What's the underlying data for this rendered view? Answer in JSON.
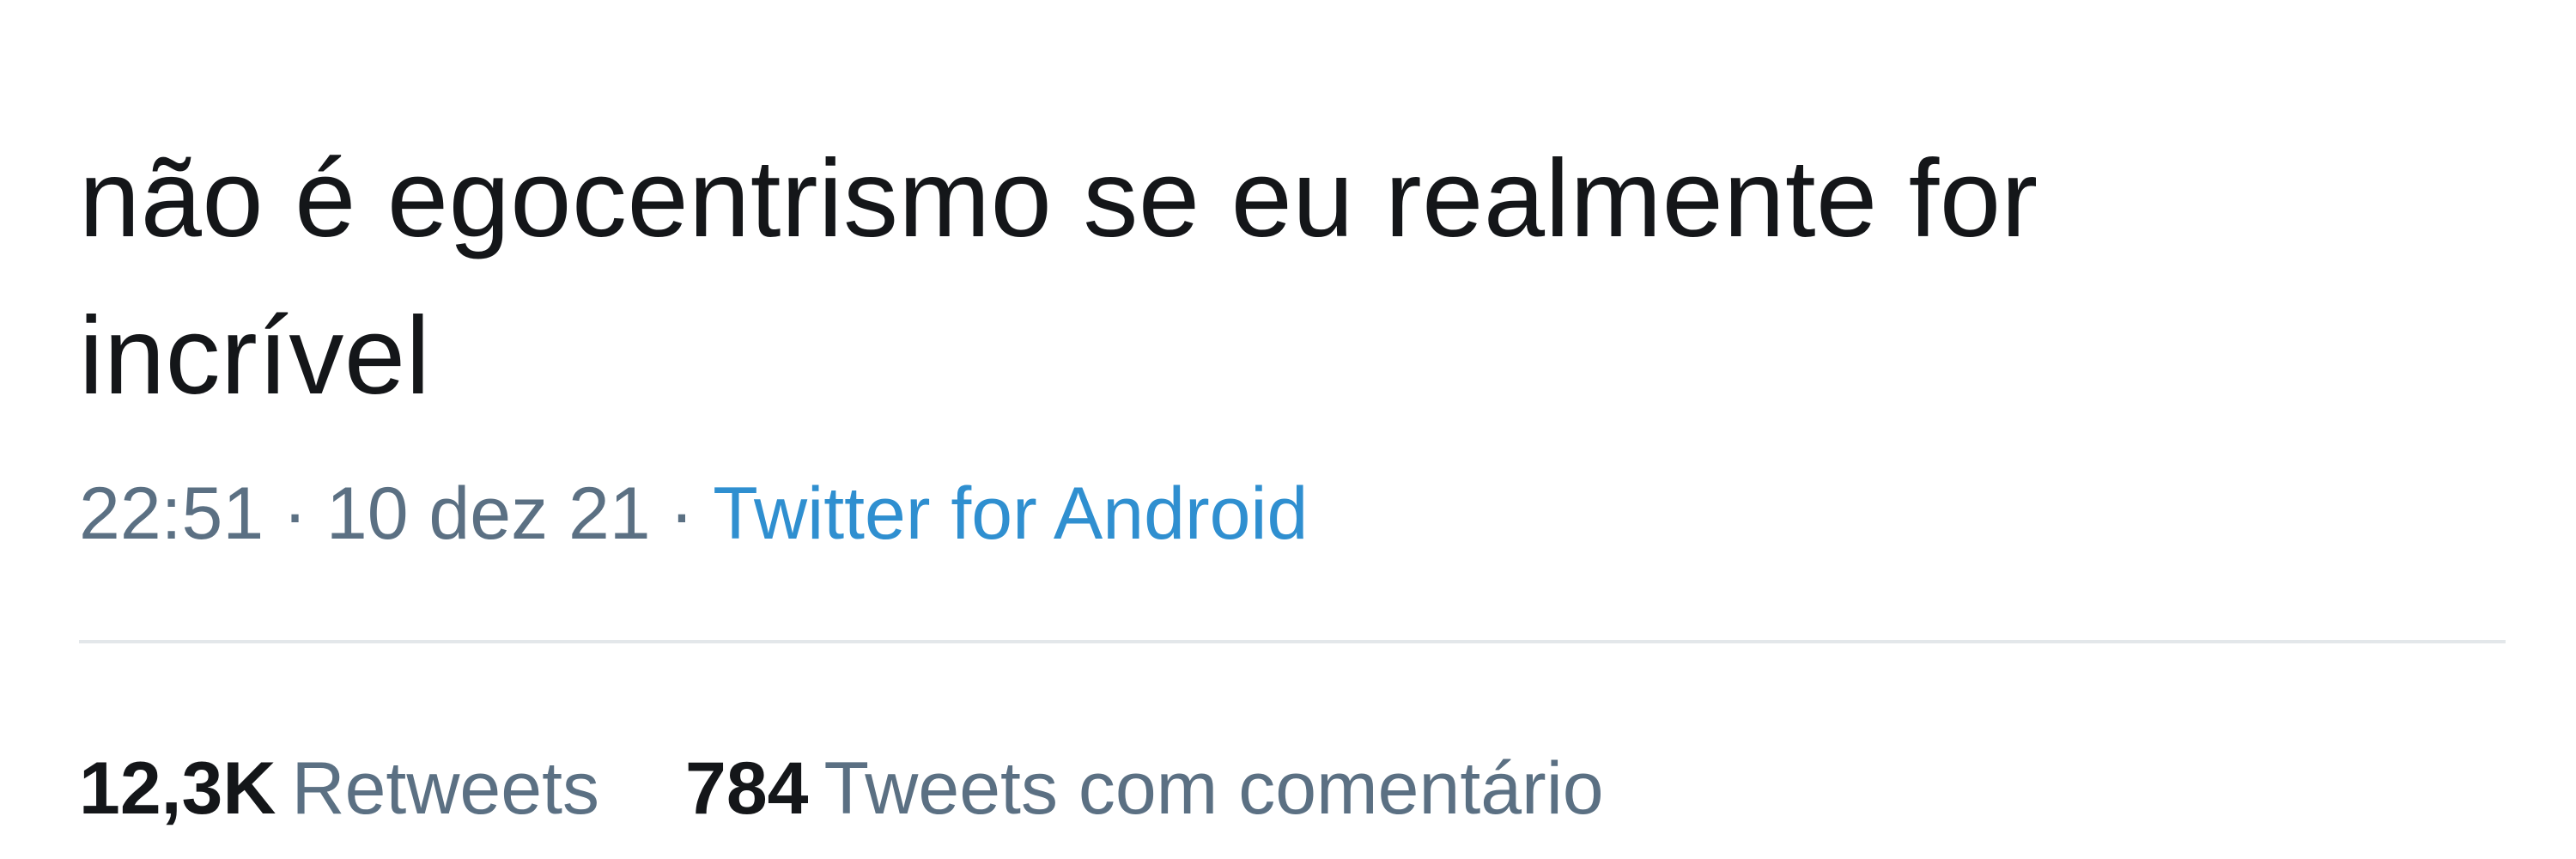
{
  "colors": {
    "avatar": "#c8141b",
    "text": "#141619",
    "secondary": "#5b7083",
    "link": "#2f8fd0",
    "divider": "#e3e7ea"
  },
  "tweet": {
    "text": "não é egocentrismo se eu realmente for incrível",
    "time": "22:51",
    "date": "10 dez 21",
    "separator": "·",
    "source": "Twitter for Android"
  },
  "stats": [
    {
      "count": "12,3K",
      "label": "Retweets"
    },
    {
      "count": "784",
      "label": "Tweets com comentário"
    }
  ]
}
